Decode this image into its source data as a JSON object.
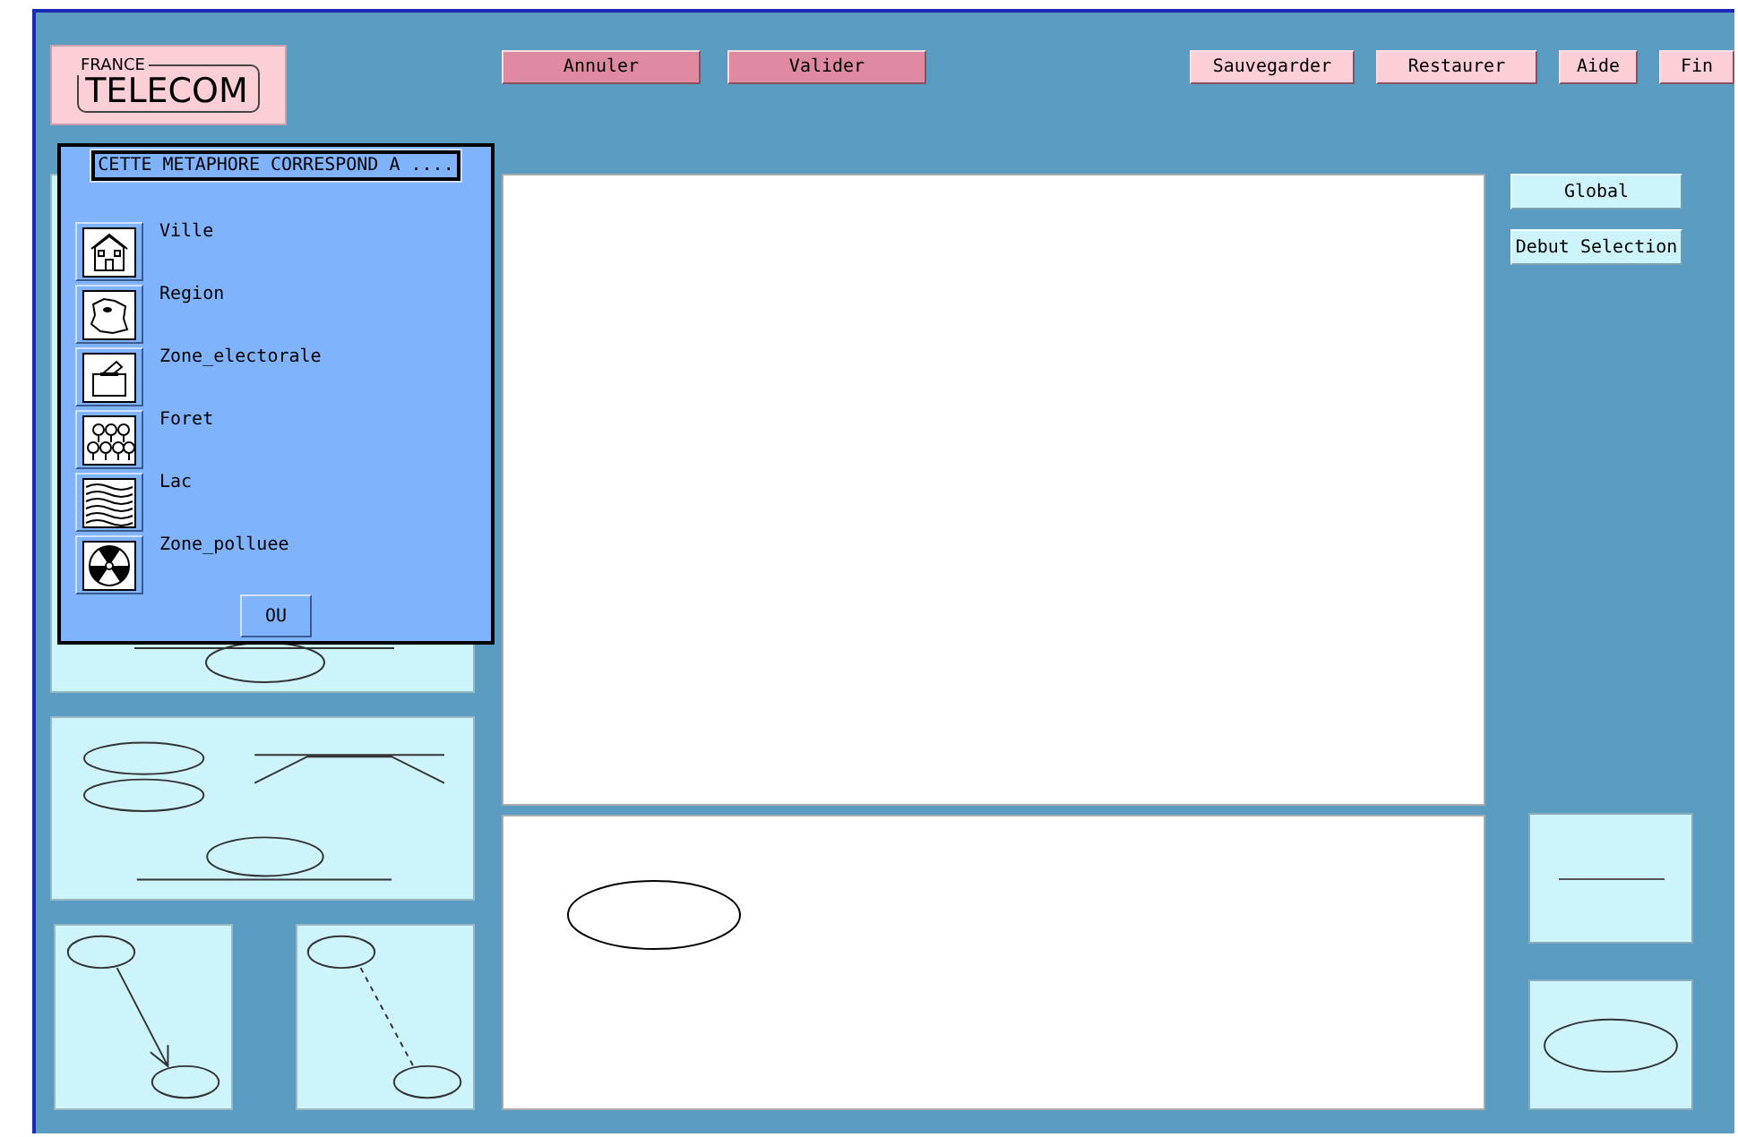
{
  "logo": {
    "top": "FRANCE",
    "main": "TELECOM"
  },
  "toolbar": {
    "left": [
      "Annuler",
      "Valider"
    ],
    "right": [
      "Sauvegarder",
      "Restaurer",
      "Aide",
      "Fin"
    ]
  },
  "side_buttons": [
    "Global",
    "Debut Selection"
  ],
  "dialog": {
    "title": "CETTE METAPHORE CORRESPOND A ....",
    "items": [
      {
        "label": "Ville",
        "kind": "city"
      },
      {
        "label": "Region",
        "kind": "region"
      },
      {
        "label": "Zone_electorale",
        "kind": "ballot"
      },
      {
        "label": "Foret",
        "kind": "forest"
      },
      {
        "label": "Lac",
        "kind": "lake"
      },
      {
        "label": "Zone_polluee",
        "kind": "radiation"
      }
    ],
    "button": "OU"
  }
}
